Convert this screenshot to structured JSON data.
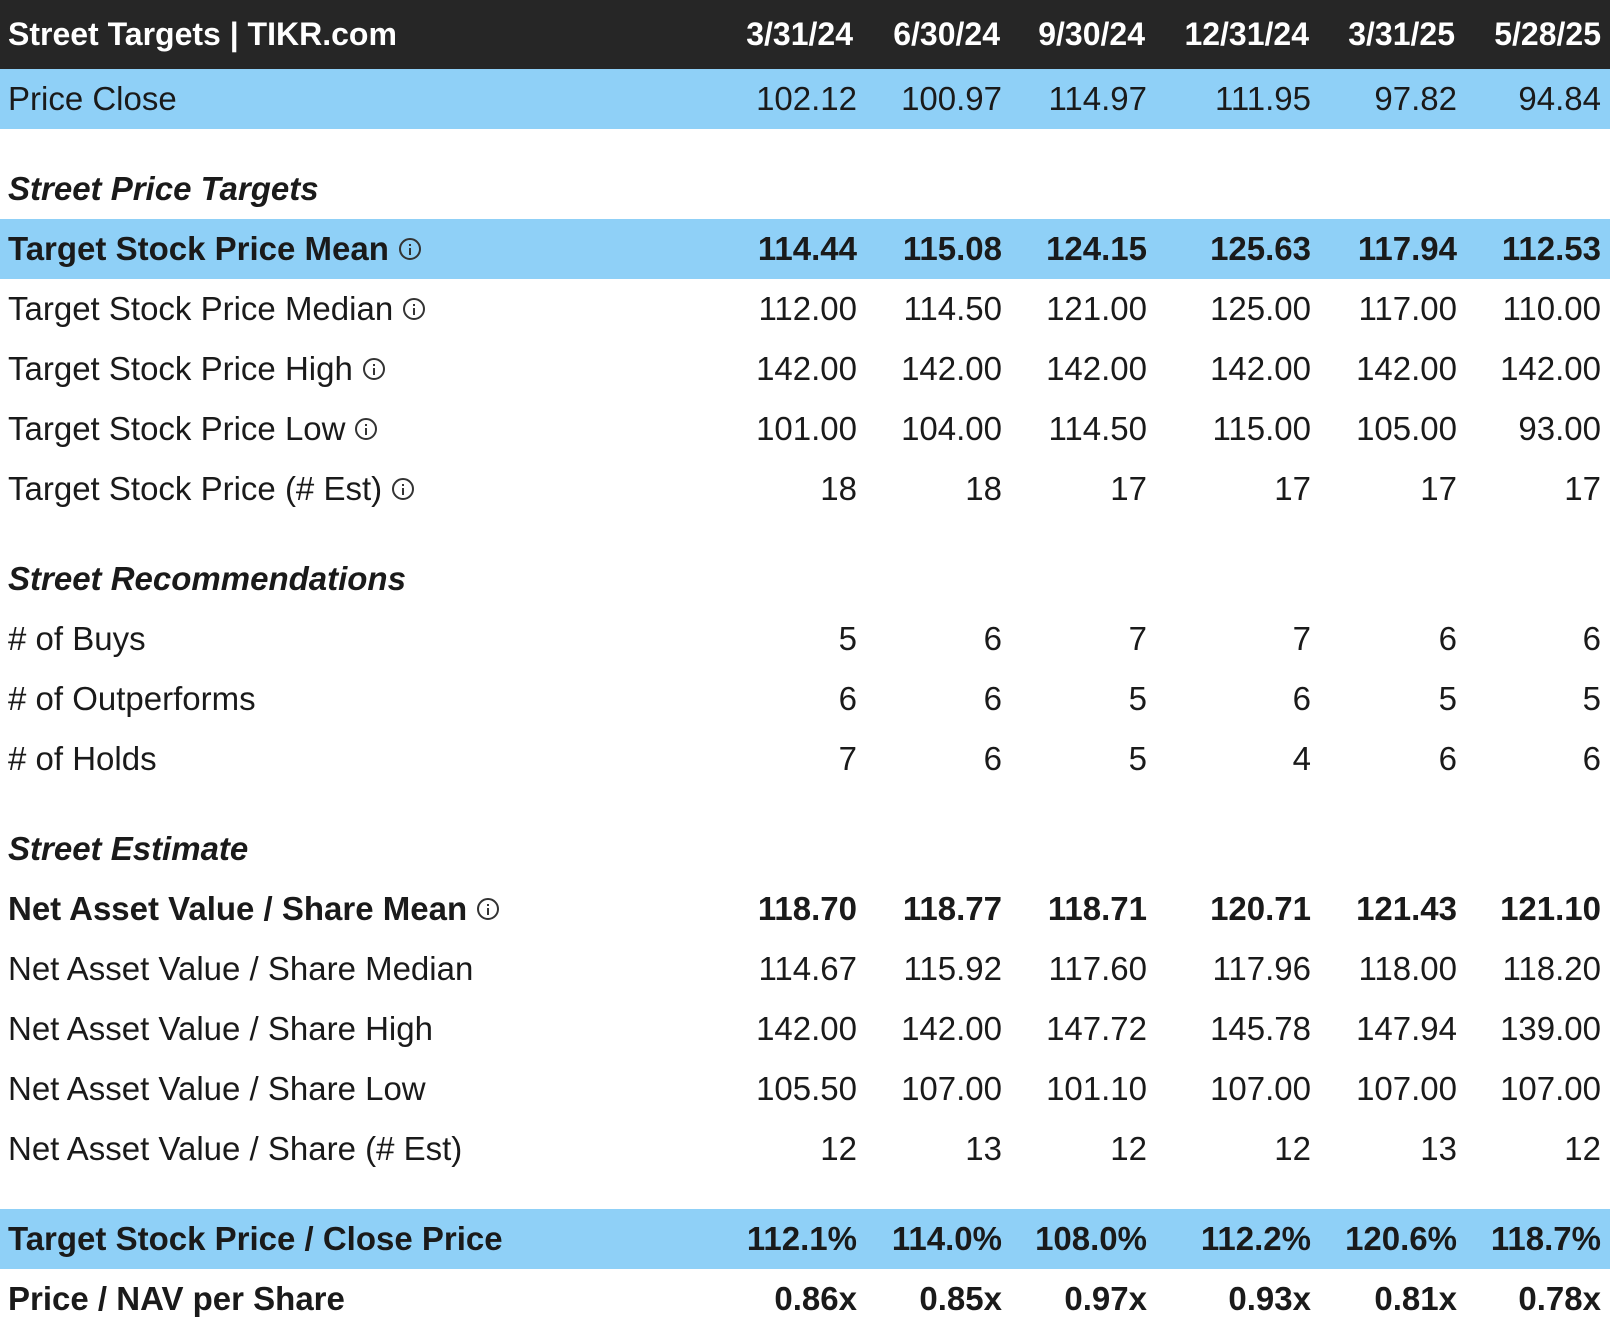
{
  "header": {
    "title": "Street Targets | TIKR.com",
    "dates": [
      "3/31/24",
      "6/30/24",
      "9/30/24",
      "12/31/24",
      "3/31/25",
      "5/28/25"
    ]
  },
  "price_close": {
    "label": "Price Close",
    "values": [
      "102.12",
      "100.97",
      "114.97",
      "111.95",
      "97.82",
      "94.84"
    ]
  },
  "sections": {
    "targets": "Street Price Targets",
    "recommendations": "Street Recommendations",
    "estimate": "Street Estimate"
  },
  "targets": [
    {
      "label": "Target Stock Price Mean",
      "values": [
        "114.44",
        "115.08",
        "124.15",
        "125.63",
        "117.94",
        "112.53"
      ]
    },
    {
      "label": "Target Stock Price Median",
      "values": [
        "112.00",
        "114.50",
        "121.00",
        "125.00",
        "117.00",
        "110.00"
      ]
    },
    {
      "label": "Target Stock Price High",
      "values": [
        "142.00",
        "142.00",
        "142.00",
        "142.00",
        "142.00",
        "142.00"
      ]
    },
    {
      "label": "Target Stock Price Low",
      "values": [
        "101.00",
        "104.00",
        "114.50",
        "115.00",
        "105.00",
        "93.00"
      ]
    },
    {
      "label": "Target Stock Price (# Est)",
      "values": [
        "18",
        "18",
        "17",
        "17",
        "17",
        "17"
      ]
    }
  ],
  "recommendations": [
    {
      "label": "# of Buys",
      "values": [
        "5",
        "6",
        "7",
        "7",
        "6",
        "6"
      ]
    },
    {
      "label": "# of Outperforms",
      "values": [
        "6",
        "6",
        "5",
        "6",
        "5",
        "5"
      ]
    },
    {
      "label": "# of Holds",
      "values": [
        "7",
        "6",
        "5",
        "4",
        "6",
        "6"
      ]
    }
  ],
  "estimate": [
    {
      "label": "Net Asset Value / Share Mean",
      "values": [
        "118.70",
        "118.77",
        "118.71",
        "120.71",
        "121.43",
        "121.10"
      ]
    },
    {
      "label": "Net Asset Value / Share Median",
      "values": [
        "114.67",
        "115.92",
        "117.60",
        "117.96",
        "118.00",
        "118.20"
      ]
    },
    {
      "label": "Net Asset Value / Share High",
      "values": [
        "142.00",
        "142.00",
        "147.72",
        "145.78",
        "147.94",
        "139.00"
      ]
    },
    {
      "label": "Net Asset Value / Share Low",
      "values": [
        "105.50",
        "107.00",
        "101.10",
        "107.00",
        "107.00",
        "107.00"
      ]
    },
    {
      "label": "Net Asset Value / Share (# Est)",
      "values": [
        "12",
        "13",
        "12",
        "12",
        "13",
        "12"
      ]
    }
  ],
  "summary": [
    {
      "label": "Target Stock Price / Close Price",
      "values": [
        "112.1%",
        "114.0%",
        "108.0%",
        "112.2%",
        "120.6%",
        "118.7%"
      ]
    },
    {
      "label": "Price / NAV per Share",
      "values": [
        "0.86x",
        "0.85x",
        "0.97x",
        "0.93x",
        "0.81x",
        "0.78x"
      ]
    }
  ],
  "colors": {
    "header_bg": "#262626",
    "highlight_bg": "#8fd0f7"
  }
}
